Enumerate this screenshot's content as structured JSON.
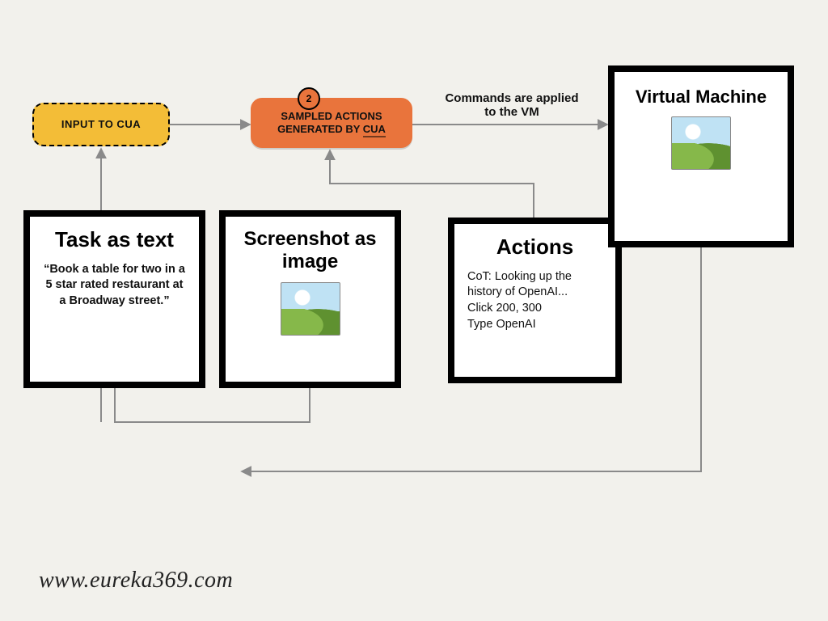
{
  "nodes": {
    "input_label": "INPUT TO CUA",
    "sampled_line1": "SAMPLED ACTIONS",
    "sampled_line2_a": "GENERATED BY ",
    "sampled_line2_b": "CUA",
    "badge": "2",
    "arrow_label_line1": "Commands are applied",
    "arrow_label_line2": "to the VM",
    "vm_title": "Virtual Machine"
  },
  "boxes": {
    "task": {
      "title": "Task as text",
      "body": "“Book a table for two in a 5 star rated restaurant at a Broadway street.”"
    },
    "shot": {
      "title": "Screenshot as image"
    },
    "actions": {
      "title": "Actions",
      "line1": "CoT: Looking up the history of OpenAI...",
      "line2": "Click 200, 300",
      "line3": "Type OpenAI"
    }
  },
  "footer": "www.eureka369.com",
  "colors": {
    "yellow": "#f3bd37",
    "orange": "#e9743c",
    "wire": "#8a8a8a"
  }
}
